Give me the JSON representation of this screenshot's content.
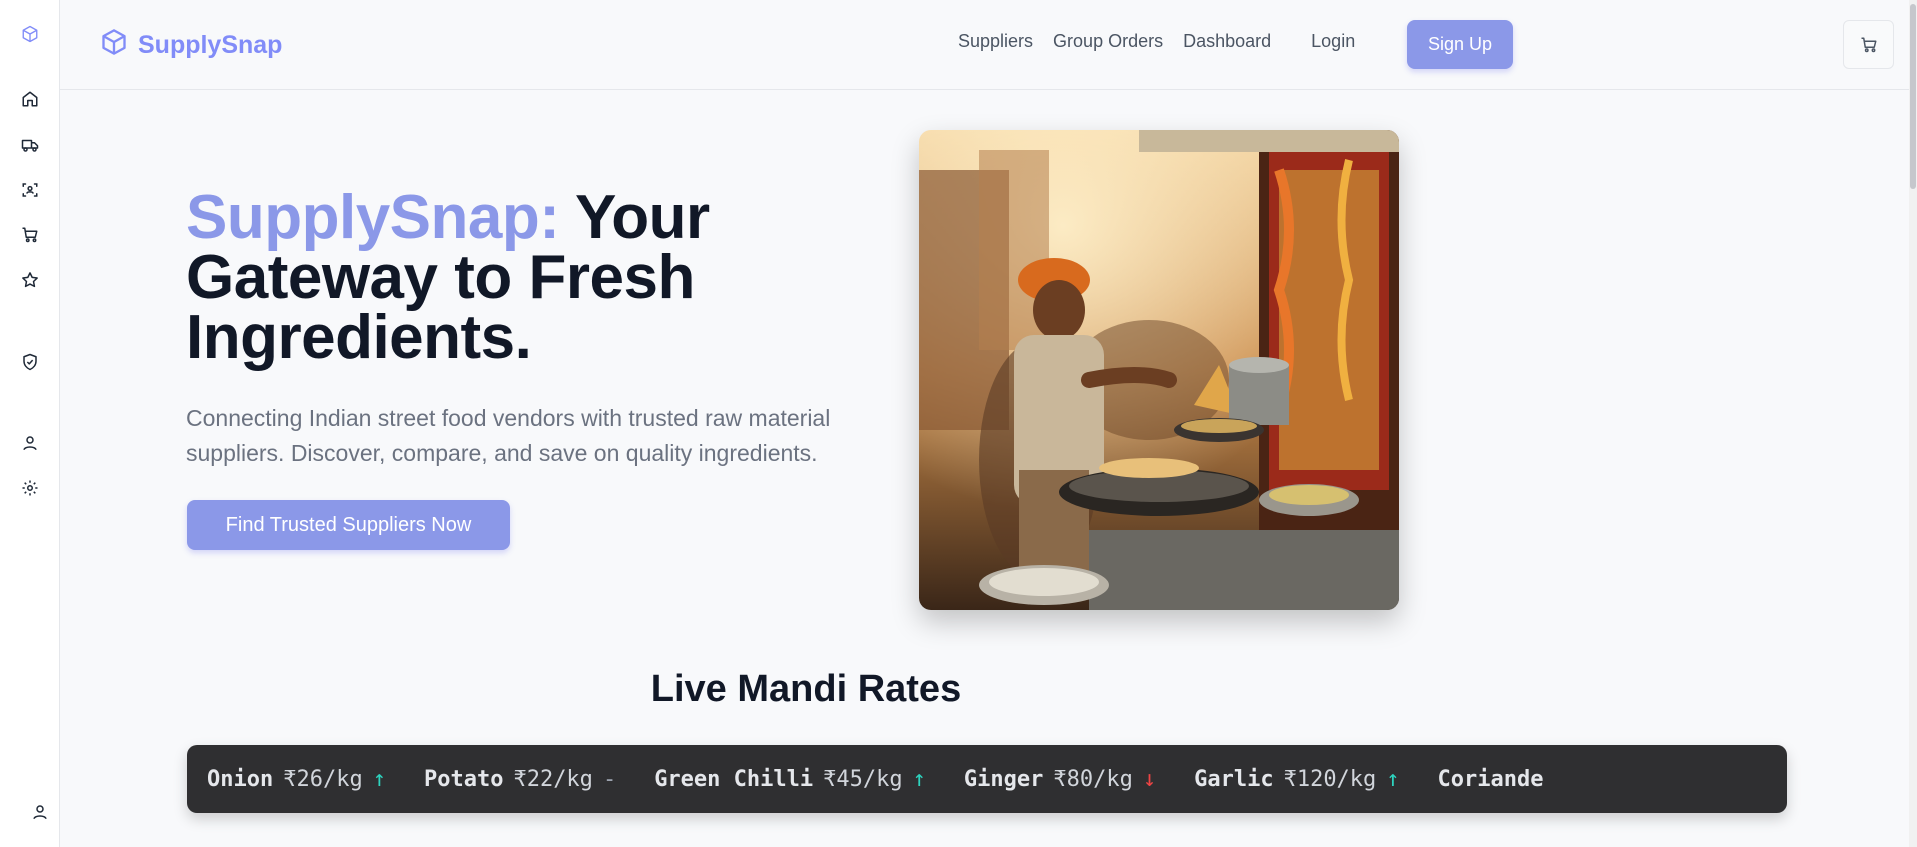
{
  "brand": {
    "name": "SupplySnap",
    "accent_color": "#8b98e8"
  },
  "rail": {
    "items": [
      {
        "icon": "box-logo-icon"
      },
      {
        "icon": "home-icon"
      },
      {
        "icon": "truck-icon"
      },
      {
        "icon": "scan-users-icon"
      },
      {
        "icon": "cart-icon"
      },
      {
        "icon": "star-icon"
      },
      {
        "icon": "shield-check-icon"
      },
      {
        "icon": "user-icon"
      },
      {
        "icon": "gear-icon"
      },
      {
        "icon": "account-icon"
      }
    ]
  },
  "nav": {
    "suppliers": "Suppliers",
    "group_orders": "Group Orders",
    "dashboard": "Dashboard",
    "login": "Login",
    "signup": "Sign Up",
    "cart_icon": "cart-icon"
  },
  "hero": {
    "title_accent": "SupplySnap:",
    "title_rest": " Your Gateway to Fresh Ingredients.",
    "subtitle": "Connecting Indian street food vendors with trusted raw material suppliers. Discover, compare, and save on quality ingredients.",
    "cta": "Find Trusted Suppliers Now"
  },
  "mandi": {
    "title": "Live Mandi Rates",
    "up_color": "#2dd4bf",
    "down_color": "#ef4444",
    "items": [
      {
        "name": "Onion",
        "price": "₹26/kg",
        "trend": "↑",
        "dir": "up"
      },
      {
        "name": "Potato",
        "price": "₹22/kg",
        "trend": "-",
        "dir": "flat"
      },
      {
        "name": "Green Chilli",
        "price": "₹45/kg",
        "trend": "↑",
        "dir": "up"
      },
      {
        "name": "Ginger",
        "price": "₹80/kg",
        "trend": "↓",
        "dir": "down"
      },
      {
        "name": "Garlic",
        "price": "₹120/kg",
        "trend": "↑",
        "dir": "up"
      },
      {
        "name": "Coriande",
        "price": "",
        "trend": "",
        "dir": "flat"
      }
    ]
  }
}
